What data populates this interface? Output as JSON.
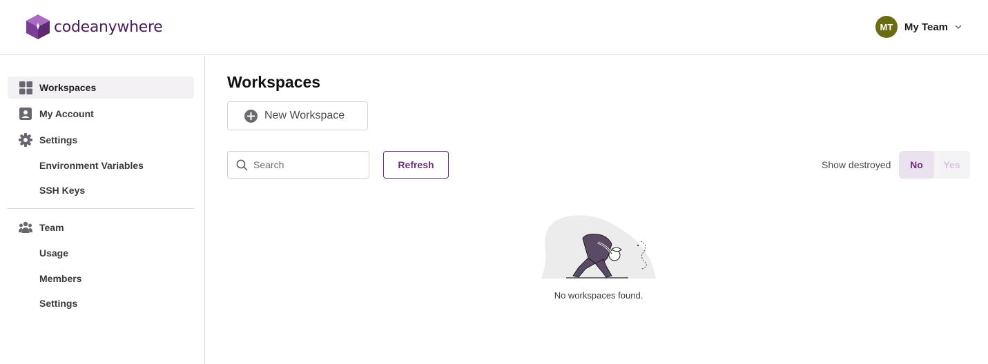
{
  "app": {
    "logo_text": "codeanywhere",
    "brand_color": "#6b2c7a"
  },
  "header": {
    "avatar_initials": "MT",
    "avatar_color": "#6b6b14",
    "team_name": "My Team",
    "dropdown_icon": "chevron-down-icon"
  },
  "sidebar": {
    "items": [
      {
        "label": "Workspaces",
        "icon": "grid-icon",
        "active": true
      },
      {
        "label": "My Account",
        "icon": "user-card-icon"
      },
      {
        "label": "Settings",
        "icon": "gear-icon"
      },
      {
        "label": "Environment Variables"
      },
      {
        "label": "SSH Keys"
      },
      {
        "label": "Team",
        "icon": "team-icon"
      },
      {
        "label": "Usage"
      },
      {
        "label": "Members"
      },
      {
        "label": "Settings"
      }
    ]
  },
  "main": {
    "title": "Workspaces",
    "new_workspace_label": "New Workspace",
    "search_placeholder": "Search",
    "refresh_label": "Refresh",
    "show_destroyed_label": "Show destroyed",
    "toggle": {
      "no_label": "No",
      "yes_label": "Yes",
      "selected": "No"
    },
    "empty_message": "No workspaces found."
  }
}
